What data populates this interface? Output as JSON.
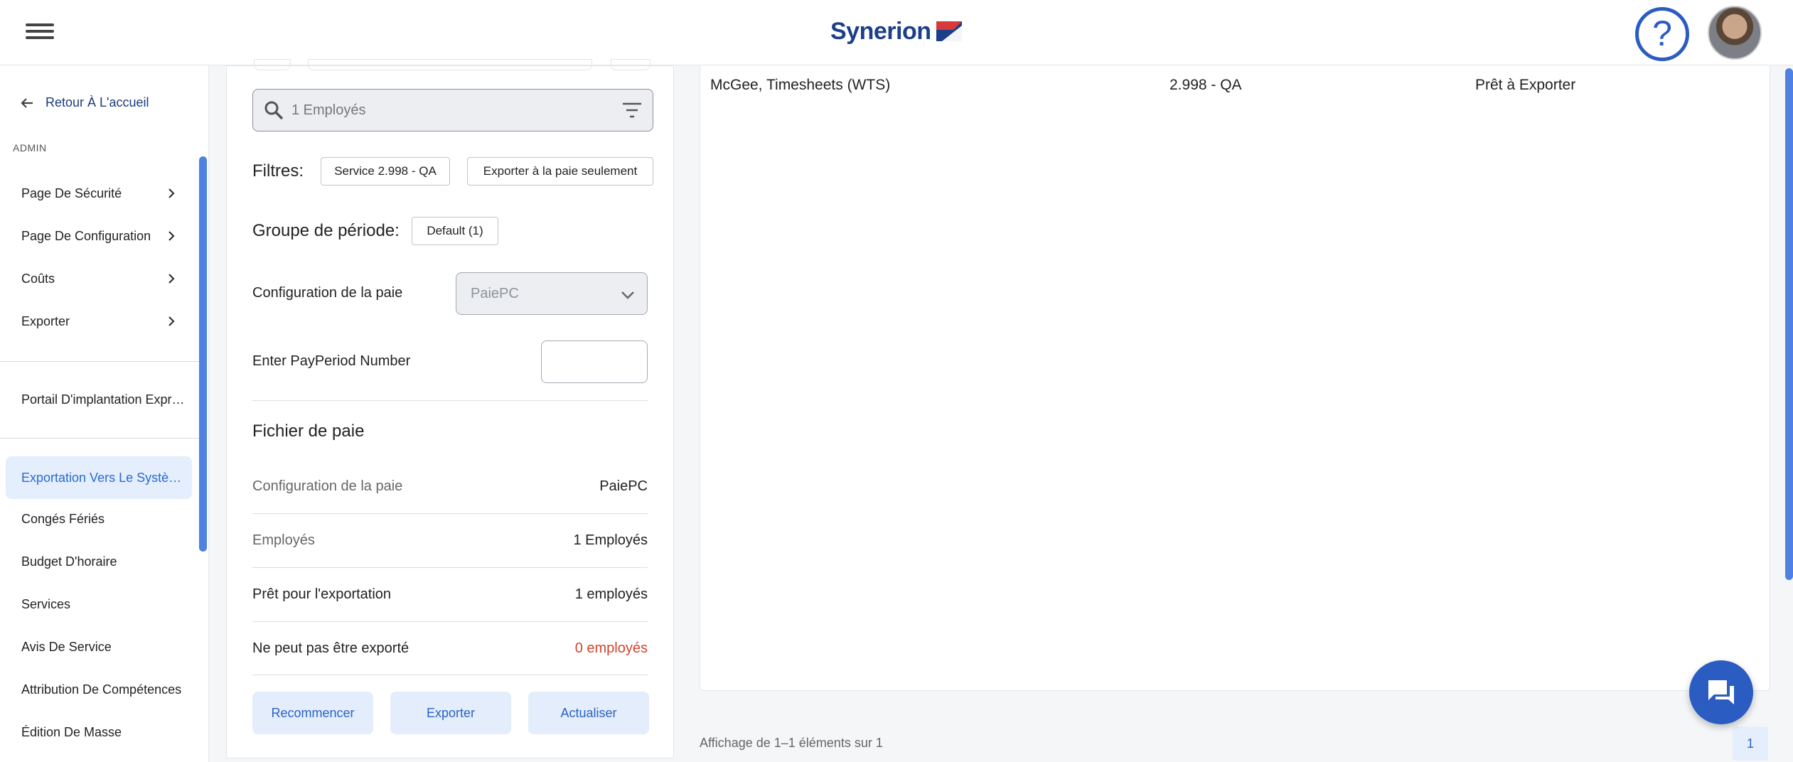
{
  "header": {
    "brand": "Synerion",
    "help_icon": "help-circle-icon",
    "menu_icon": "hamburger-icon"
  },
  "sidebar": {
    "back_label": "Retour À L'accueil",
    "section": "ADMIN",
    "menu": [
      {
        "label": "Page De Sécurité"
      },
      {
        "label": "Page De Configuration"
      },
      {
        "label": "Coûts"
      },
      {
        "label": "Exporter"
      }
    ],
    "portal": "Portail D'implantation Expr…",
    "items": [
      {
        "label": "Exportation Vers Le Systè…"
      },
      {
        "label": "Congés Fériés"
      },
      {
        "label": "Budget D'horaire"
      },
      {
        "label": "Services"
      },
      {
        "label": "Avis De Service"
      },
      {
        "label": "Attribution De Compétences"
      },
      {
        "label": "Édition De Masse"
      }
    ]
  },
  "panel": {
    "search_placeholder": "1 Employés",
    "filters_label": "Filtres:",
    "filter_chips": [
      "Service 2.998 - QA",
      "Exporter à la paie seulement"
    ],
    "period_group_label": "Groupe de période:",
    "period_group_value": "Default (1)",
    "payroll_config_label": "Configuration de la paie",
    "payroll_config_value": "PaiePC",
    "payperiod_label": "Enter PayPeriod Number",
    "payperiod_value": "",
    "file_title": "Fichier de paie",
    "summary": [
      {
        "label": "Configuration de la paie",
        "value": "PaiePC"
      },
      {
        "label": "Employés",
        "value": "1 Employés"
      },
      {
        "label": "Prêt pour l'exportation",
        "value": "1 employés"
      },
      {
        "label": "Ne peut pas être exporté",
        "value": "0 employés"
      }
    ],
    "buttons": {
      "restart": "Recommencer",
      "export": "Exporter",
      "refresh": "Actualiser"
    }
  },
  "table": {
    "rows": [
      {
        "name": "McGee, Timesheets (WTS)",
        "service": "2.998 - QA",
        "status": "Prêt à Exporter"
      }
    ],
    "footer": "Affichage de 1–1 éléments sur 1",
    "page": "1"
  },
  "colors": {
    "accent": "#2a5cc2",
    "error": "#d0452d",
    "active_bg": "#e4eefc"
  }
}
